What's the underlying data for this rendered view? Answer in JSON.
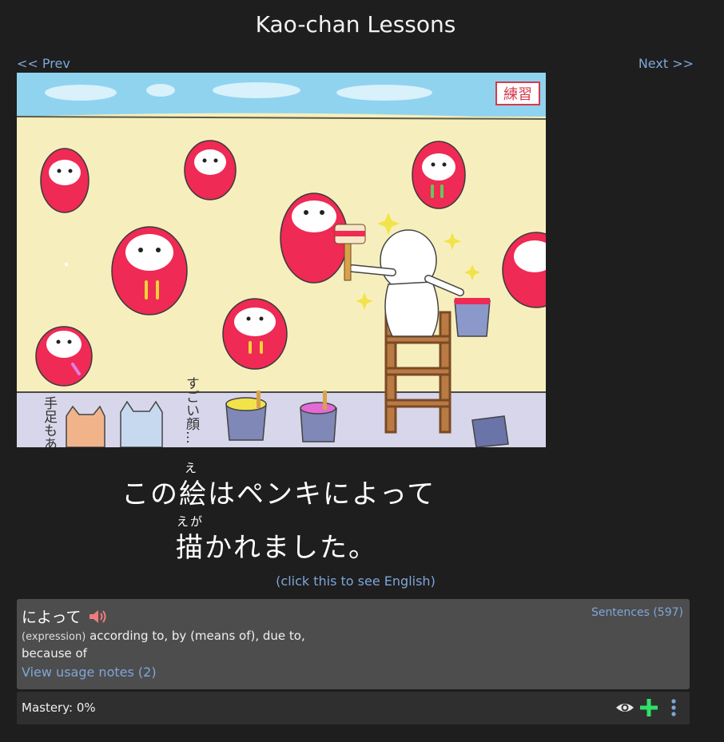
{
  "header": {
    "title": "Kao-chan Lessons",
    "prev_label": "<< Prev",
    "next_label": "Next >>"
  },
  "illustration": {
    "stamp_text": "練習",
    "handwritten_left": "手足もあるね",
    "handwritten_middle": "すごい顔…"
  },
  "sentence": {
    "line1_pre": "この",
    "line1_kanji": "絵",
    "line1_reading": "え",
    "line1_post": "はペンキによって",
    "line2_kanji": "描",
    "line2_reading": "えが",
    "line2_post": "かれました。"
  },
  "english_toggle": "(click this to see English)",
  "word": {
    "term": "によって",
    "sentences_link": "Sentences (597)",
    "part_of_speech": "(expression)",
    "definition": "according to, by (means of), due to, because of",
    "usage_link": "View usage notes (2)"
  },
  "mastery": {
    "label": "Mastery: 0%"
  },
  "icons": {
    "speaker": "speaker-icon",
    "eye": "eye-icon",
    "plus": "plus-icon",
    "more": "kebab-menu-icon"
  },
  "colors": {
    "link": "#7fa6d9",
    "plus": "#2fe06a",
    "speaker": "#f07b7b",
    "daruma": "#ee2a55"
  }
}
